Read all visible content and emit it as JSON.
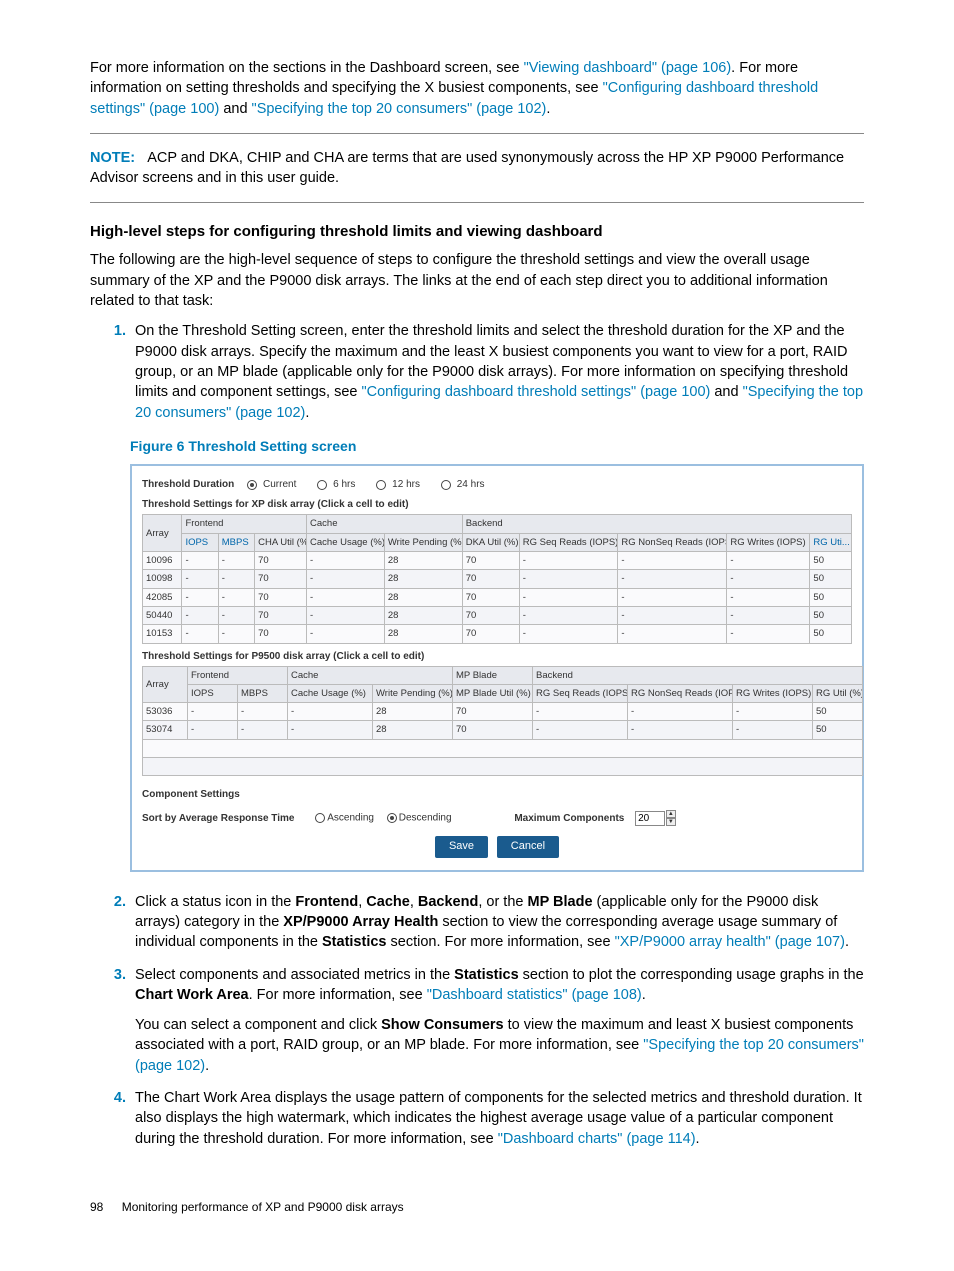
{
  "intro": {
    "p1_a": "For more information on the sections in the Dashboard screen, see ",
    "p1_link1": "\"Viewing dashboard\" (page 106)",
    "p1_b": ". For more information on setting thresholds and specifying the X busiest components, see ",
    "p1_link2": "\"Configuring dashboard threshold settings\" (page 100)",
    "p1_c": " and ",
    "p1_link3": "\"Specifying the top 20 consumers\" (page 102)",
    "p1_d": "."
  },
  "note": {
    "label": "NOTE:",
    "text": "ACP and DKA, CHIP and CHA are terms that are used synonymously across the HP XP P9000 Performance Advisor screens and in this user guide."
  },
  "section_title": "High-level steps for configuring threshold limits and viewing dashboard",
  "section_intro": "The following are the high-level sequence of steps to configure the threshold settings and view the overall usage summary of the XP and the P9000 disk arrays. The links at the end of each step direct you to additional information related to that task:",
  "step1": {
    "text_a": "On the Threshold Setting screen, enter the threshold limits and select the threshold duration for the XP and the P9000 disk arrays. Specify the maximum and the least X busiest components you want to view for a port, RAID group, or an MP blade (applicable only for the P9000 disk arrays). For more information on specifying threshold limits and component settings, see ",
    "link1": "\"Configuring dashboard threshold settings\" (page 100)",
    "text_b": " and ",
    "link2": "\"Specifying the top 20 consumers\" (page 102)",
    "text_c": "."
  },
  "figure_caption": "Figure 6 Threshold Setting screen",
  "figure": {
    "duration_label": "Threshold Duration",
    "dur_opts": [
      "Current",
      "6 hrs",
      "12 hrs",
      "24 hrs"
    ],
    "xp_caption": "Threshold Settings for XP disk array (Click a cell to edit)",
    "xp_group": {
      "array": "Array",
      "frontend": "Frontend",
      "cache": "Cache",
      "backend": "Backend"
    },
    "xp_cols": [
      "IOPS",
      "MBPS",
      "CHA Util (%)",
      "Cache Usage (%)",
      "Write Pending (%)",
      "DKA Util (%)",
      "RG Seq Reads (IOPS)",
      "RG NonSeq Reads (IOPS)",
      "RG Writes (IOPS)",
      "RG Uti..."
    ],
    "xp_rows": [
      {
        "array": "10096",
        "iops": "-",
        "mbps": "-",
        "cha": "70",
        "cu": "-",
        "wp": "28",
        "dka": "70",
        "seq": "-",
        "nseq": "-",
        "rgw": "-",
        "rgu": "50"
      },
      {
        "array": "10098",
        "iops": "-",
        "mbps": "-",
        "cha": "70",
        "cu": "-",
        "wp": "28",
        "dka": "70",
        "seq": "-",
        "nseq": "-",
        "rgw": "-",
        "rgu": "50"
      },
      {
        "array": "42085",
        "iops": "-",
        "mbps": "-",
        "cha": "70",
        "cu": "-",
        "wp": "28",
        "dka": "70",
        "seq": "-",
        "nseq": "-",
        "rgw": "-",
        "rgu": "50"
      },
      {
        "array": "50440",
        "iops": "-",
        "mbps": "-",
        "cha": "70",
        "cu": "-",
        "wp": "28",
        "dka": "70",
        "seq": "-",
        "nseq": "-",
        "rgw": "-",
        "rgu": "50"
      },
      {
        "array": "10153",
        "iops": "-",
        "mbps": "-",
        "cha": "70",
        "cu": "-",
        "wp": "28",
        "dka": "70",
        "seq": "-",
        "nseq": "-",
        "rgw": "-",
        "rgu": "50"
      }
    ],
    "p9_caption": "Threshold Settings for P9500 disk array (Click a cell to edit)",
    "p9_group": {
      "array": "Array",
      "frontend": "Frontend",
      "cache": "Cache",
      "mpblade": "MP Blade",
      "backend": "Backend"
    },
    "p9_cols": [
      "IOPS",
      "MBPS",
      "Cache Usage (%)",
      "Write Pending (%)",
      "MP Blade Util (%)",
      "RG Seq Reads (IOPS)",
      "RG NonSeq Reads (IOPS)",
      "RG Writes (IOPS)",
      "RG Util (%)"
    ],
    "p9_rows": [
      {
        "array": "53036",
        "iops": "-",
        "mbps": "-",
        "cu": "-",
        "wp": "28",
        "mp": "70",
        "seq": "-",
        "nseq": "-",
        "rgw": "-",
        "rgu": "50"
      },
      {
        "array": "53074",
        "iops": "-",
        "mbps": "-",
        "cu": "-",
        "wp": "28",
        "mp": "70",
        "seq": "-",
        "nseq": "-",
        "rgw": "-",
        "rgu": "50"
      }
    ],
    "comp_label": "Component Settings",
    "sort_label": "Sort by Average Response Time",
    "sort_opts": [
      "Ascending",
      "Descending"
    ],
    "max_label": "Maximum Components",
    "max_value": "20",
    "save": "Save",
    "cancel": "Cancel"
  },
  "step2": {
    "a": "Click a status icon in the ",
    "b1": "Frontend",
    "c": ", ",
    "b2": "Cache",
    "d": ", ",
    "b3": "Backend",
    "e": ", or the ",
    "b4": "MP Blade",
    "f": " (applicable only for the P9000 disk arrays) category in the ",
    "b5": "XP/P9000 Array Health",
    "g": " section to view the corresponding average usage summary of individual components in the ",
    "b6": "Statistics",
    "h": " section. For more information, see ",
    "link": "\"XP/P9000 array health\" (page 107)",
    "i": "."
  },
  "step3": {
    "a": "Select components and associated metrics in the ",
    "b1": "Statistics",
    "c": " section to plot the corresponding usage graphs in the ",
    "b2": "Chart Work Area",
    "d": ". For more information, see ",
    "link1": "\"Dashboard statistics\" (page 108)",
    "e": ".",
    "p2a": "You can select a component and click ",
    "b3": "Show Consumers",
    "p2b": " to view the maximum and least X busiest components associated with a port, RAID group, or an MP blade. For more information, see ",
    "link2": "\"Specifying the top 20 consumers\" (page 102)",
    "p2c": "."
  },
  "step4": {
    "a": "The Chart Work Area displays the usage pattern of components for the selected metrics and threshold duration. It also displays the high watermark, which indicates the highest average usage value of a particular component during the threshold duration. For more information, see ",
    "link": "\"Dashboard charts\" (page 114)",
    "b": "."
  },
  "footer": {
    "page": "98",
    "title": "Monitoring performance of XP and P9000 disk arrays"
  }
}
